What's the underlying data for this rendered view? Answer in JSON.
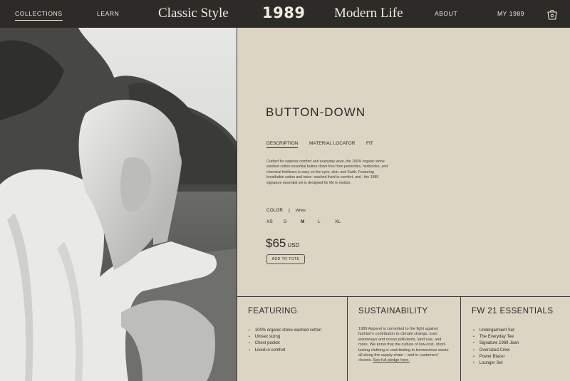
{
  "nav": {
    "collections": "COLLECTIONS",
    "learn": "LEARN",
    "classic": "Classic Style",
    "logo": "1989",
    "modern": "Modern Life",
    "about": "ABOUT",
    "my": "MY 1989",
    "bag_icon": "shopping-bag-icon"
  },
  "photo": {
    "alt": "black-and-white photo of model in button-down shirt"
  },
  "product": {
    "title": "BUTTON-DOWN",
    "tabs": [
      "DESCRIPTION",
      "MATERIAL LOCATOR",
      "FIT"
    ],
    "description": "Crafted for superior comfort and everyday wear, the 100% organic stone washed cotton essential button-down free from pesticides, herbicides, and chemical fertilizers is easy on the eyes, skin, and Earth. Featuring breathable cotton and twice- washed lived-in comfort, and , the 1989 signature essential set is designed for life in motion.",
    "color_label": "COLOR",
    "color_sep": "|",
    "color_value": "White",
    "sizes": [
      "XS",
      "S",
      "M",
      "L",
      "XL"
    ],
    "selected_size": "M",
    "price": "$65",
    "currency": "USD",
    "add_to_tote": "ADD TO TOTE"
  },
  "featuring": {
    "title": "FEATURING",
    "items": [
      "100% organic stone washed cotton",
      "Unisex sizing",
      "Chest pocket",
      "Lived-in comfort"
    ]
  },
  "sustainability": {
    "title": "SUSTAINABILITY",
    "text": "1989 Apparel is commited to the fight against fashion’s contributon to climate change, toxic waterways and ocean pollutants, land use, and more. We know that the culture of low-cost, short-lasting clothing is contributing to tremendous waste all along the supply chain – and in customers’ closets.",
    "link": "See full pledge here."
  },
  "essentials": {
    "title": "FW 21 ESSENTIALS",
    "items": [
      "Undergarment Set",
      "The Everyday Tee",
      "Signature 1989 Jean",
      "Oversized Crew",
      "Power Blazer",
      "Lounger Set"
    ]
  },
  "colors": {
    "nav_bg": "#2c2b28",
    "panel_bg": "#dcd5c4",
    "ink": "#2b2a27"
  }
}
